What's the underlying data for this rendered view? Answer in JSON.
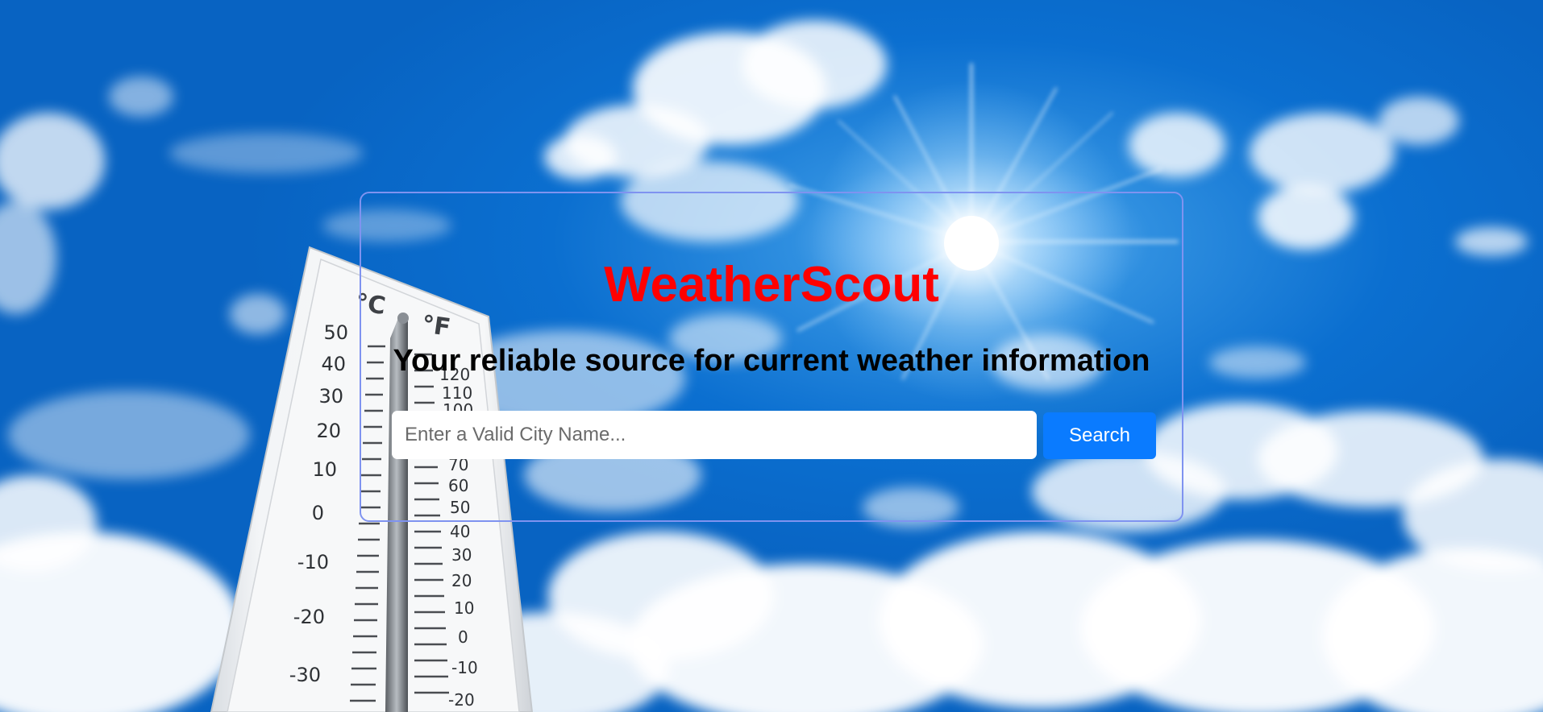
{
  "hero": {
    "title": "WeatherScout",
    "subtitle": "Your reliable source for current weather information"
  },
  "search": {
    "placeholder": "Enter a Valid City Name...",
    "value": "",
    "button_label": "Search"
  },
  "thermometer": {
    "unit_c": "°C",
    "unit_f": "°F",
    "celsius_ticks": [
      "50",
      "40",
      "30",
      "20",
      "10",
      "0",
      "-10",
      "-20",
      "-30"
    ],
    "fahrenheit_ticks": [
      "120",
      "110",
      "100",
      "70",
      "60",
      "50",
      "40",
      "30",
      "20",
      "10",
      "0",
      "-10",
      "-20"
    ]
  },
  "colors": {
    "title": "#ff0000",
    "button": "#0a7bff",
    "card_border": "#7f93f0",
    "sky": "#0b6fd0"
  }
}
